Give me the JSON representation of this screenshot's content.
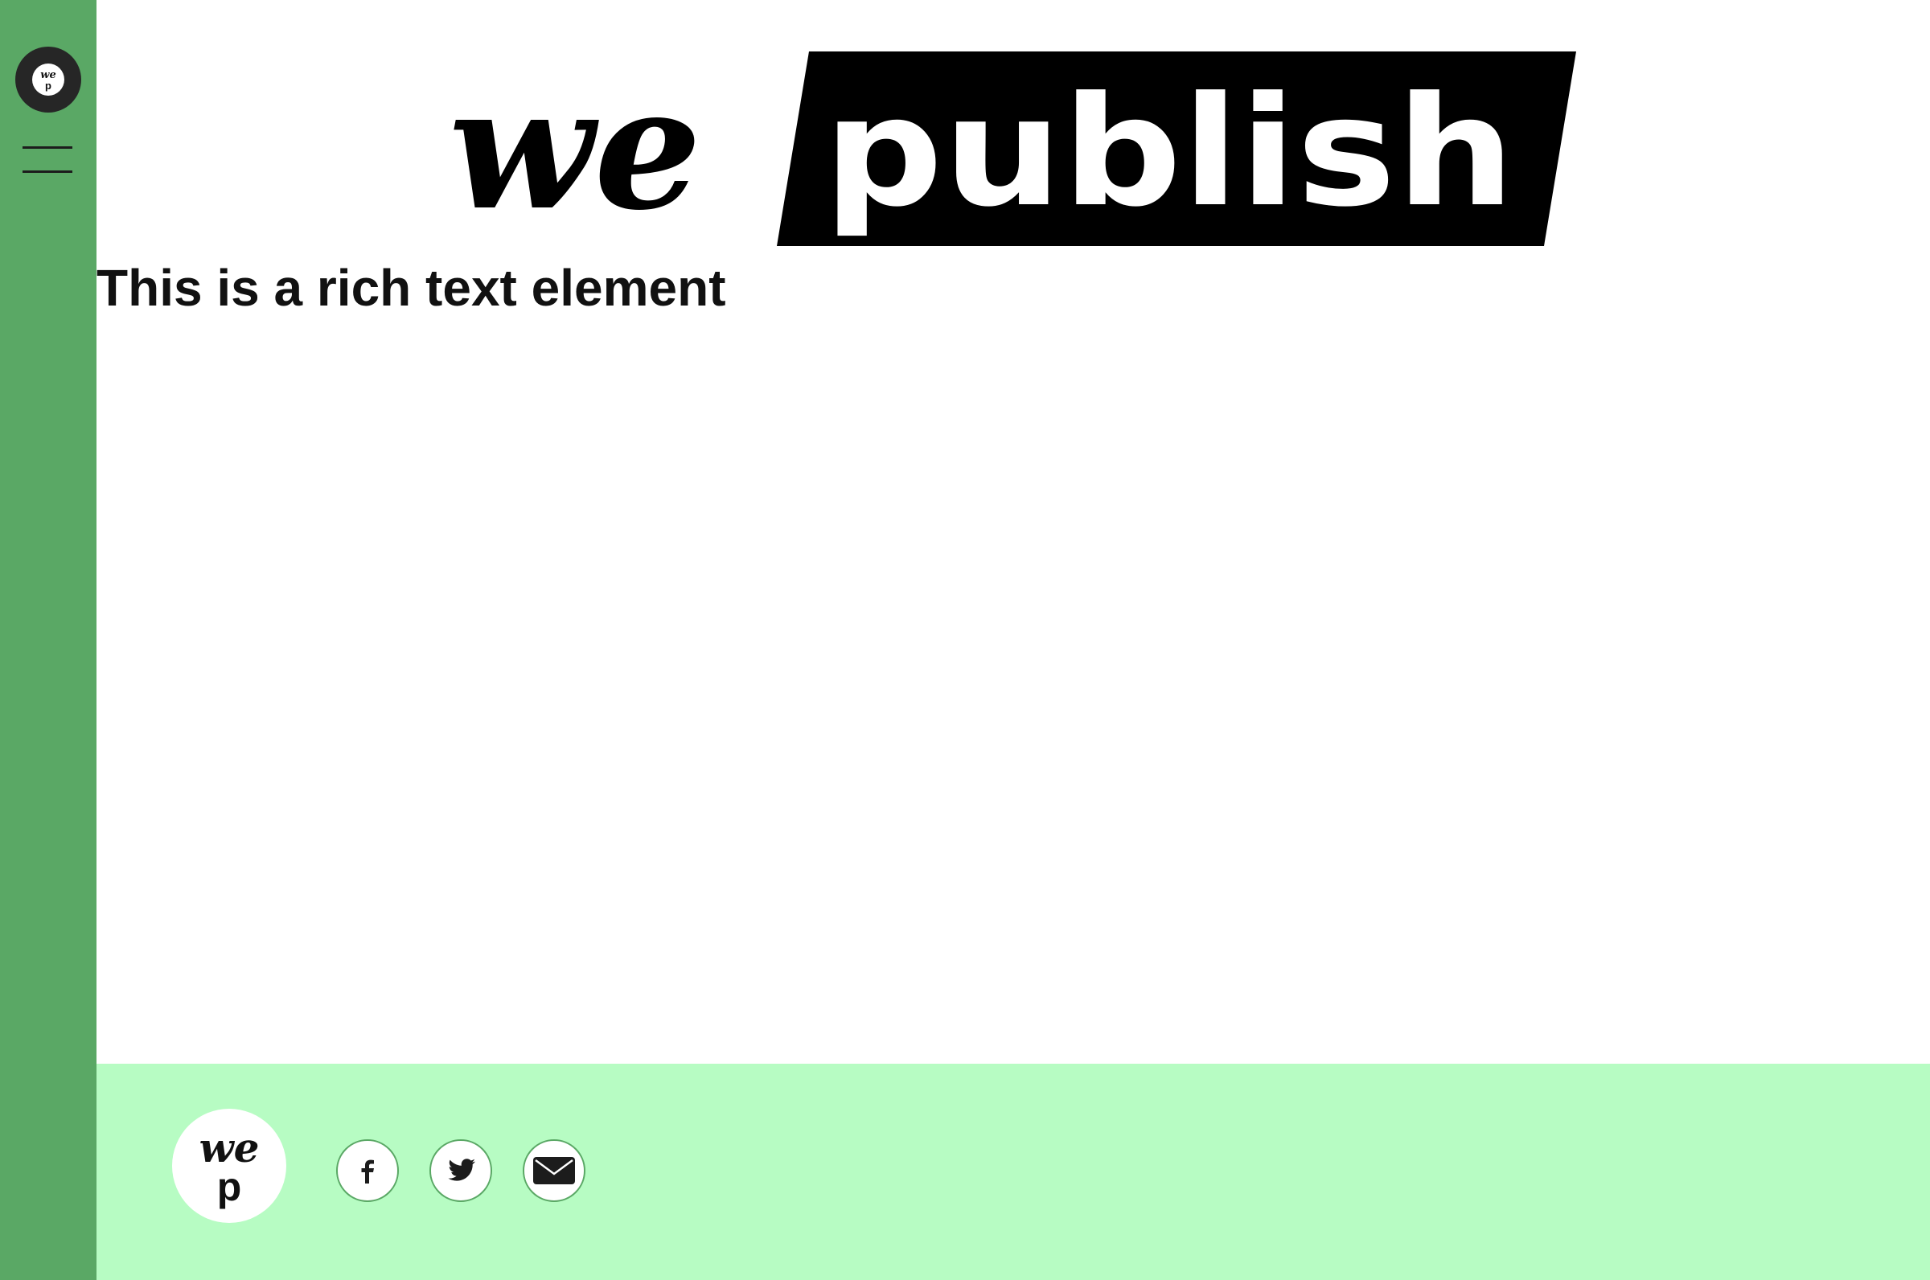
{
  "sidebar": {
    "logo_icon": "we-publish-mark-icon",
    "menu_icon": "hamburger-menu-icon"
  },
  "header": {
    "logo": {
      "script_text": "we",
      "block_text": "publish"
    }
  },
  "content": {
    "rich_text": "This is a rich text element"
  },
  "footer": {
    "logo": {
      "top_text": "we",
      "bottom_text": "p"
    },
    "social": [
      {
        "name": "facebook",
        "icon": "facebook-icon"
      },
      {
        "name": "twitter",
        "icon": "twitter-icon"
      },
      {
        "name": "email",
        "icon": "mail-icon"
      }
    ]
  },
  "colors": {
    "sidebar": "#5aa865",
    "footer": "#b7fcc3",
    "logo_block": "#000000",
    "dark_circle": "#262626",
    "page_background": "#ffffff"
  }
}
